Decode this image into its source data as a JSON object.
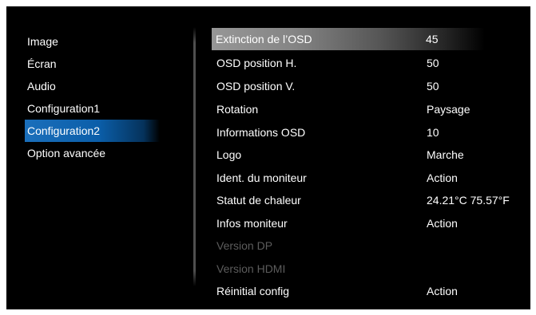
{
  "menu": {
    "items": [
      {
        "label": "Image",
        "selected": false
      },
      {
        "label": "Écran",
        "selected": false
      },
      {
        "label": "Audio",
        "selected": false
      },
      {
        "label": "Configuration1",
        "selected": false
      },
      {
        "label": "Configuration2",
        "selected": true
      },
      {
        "label": "Option avancée",
        "selected": false
      }
    ]
  },
  "settings": {
    "rows": [
      {
        "label": "Extinction de l’OSD",
        "value": "45",
        "highlighted": true,
        "enabled": true
      },
      {
        "label": "OSD position H.",
        "value": "50",
        "highlighted": false,
        "enabled": true
      },
      {
        "label": "OSD position V.",
        "value": "50",
        "highlighted": false,
        "enabled": true
      },
      {
        "label": "Rotation",
        "value": "Paysage",
        "highlighted": false,
        "enabled": true
      },
      {
        "label": "Informations OSD",
        "value": "10",
        "highlighted": false,
        "enabled": true
      },
      {
        "label": "Logo",
        "value": "Marche",
        "highlighted": false,
        "enabled": true
      },
      {
        "label": "Ident. du moniteur",
        "value": "Action",
        "highlighted": false,
        "enabled": true
      },
      {
        "label": "Statut de chaleur",
        "value": "24.21°C 75.57°F",
        "highlighted": false,
        "enabled": true
      },
      {
        "label": "Infos moniteur",
        "value": "Action",
        "highlighted": false,
        "enabled": true
      },
      {
        "label": "Version DP",
        "value": "",
        "highlighted": false,
        "enabled": false
      },
      {
        "label": "Version HDMI",
        "value": "",
        "highlighted": false,
        "enabled": false
      },
      {
        "label": "Réinitial config",
        "value": "Action",
        "highlighted": false,
        "enabled": true
      }
    ]
  },
  "colors": {
    "background": "#000000",
    "text": "#ffffff",
    "disabled_text": "#5c5c5c",
    "menu_selected": "#0b5ea9",
    "row_highlight": "#8a8a8a"
  }
}
